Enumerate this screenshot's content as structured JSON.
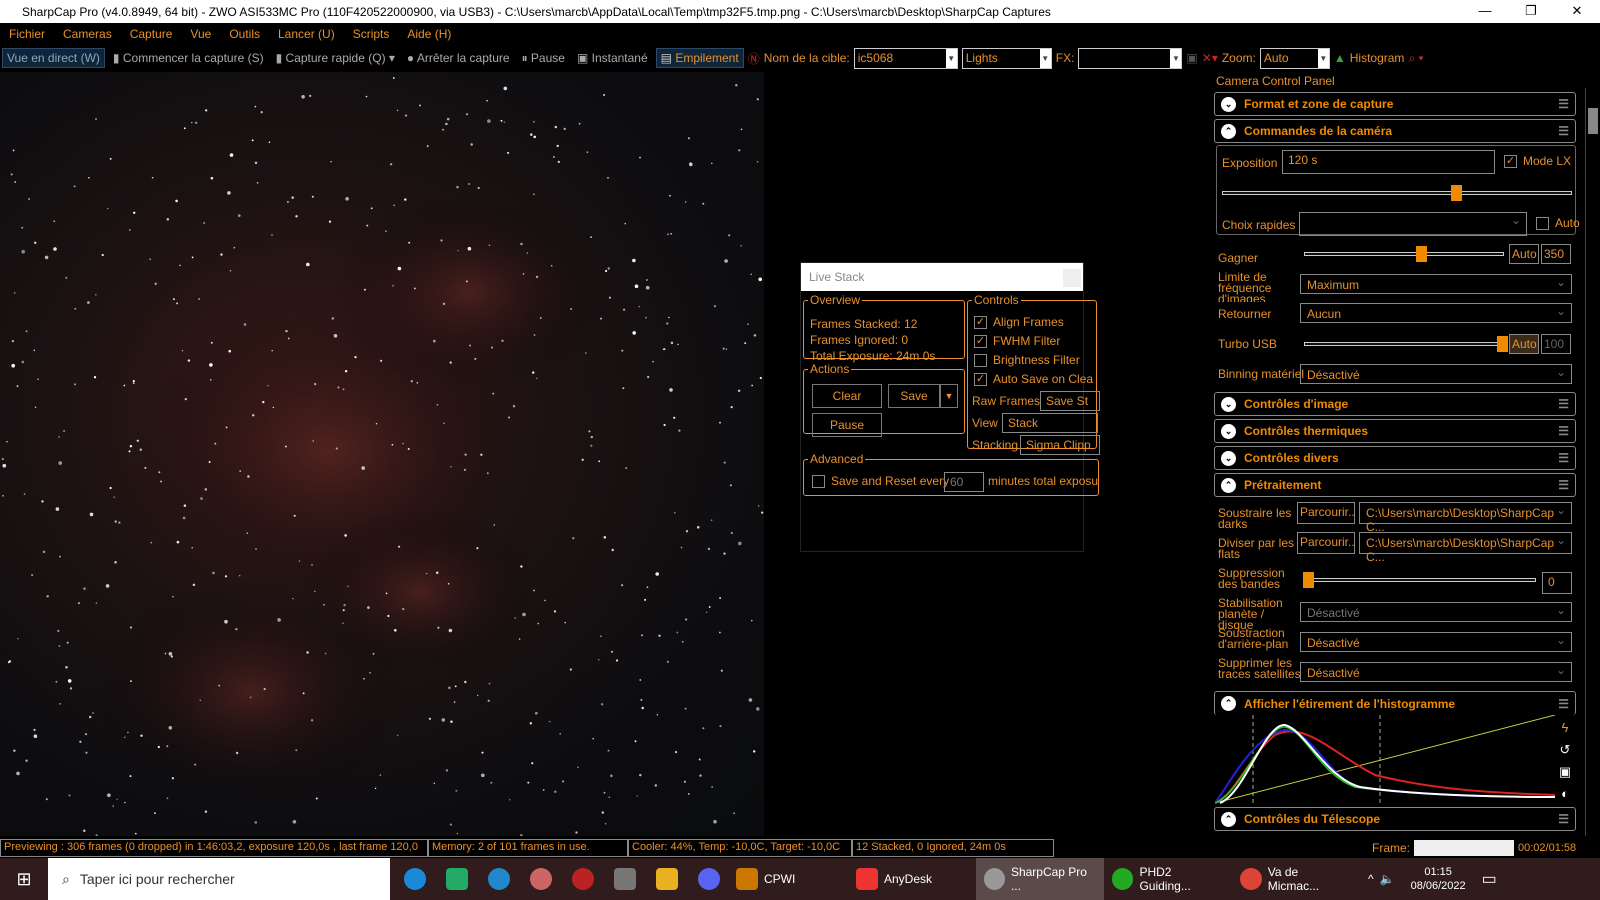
{
  "window": {
    "title": "SharpCap Pro (v4.0.8949, 64 bit) - ZWO ASI533MC Pro (110F420522000900, via USB3) - C:\\Users\\marcb\\AppData\\Local\\Temp\\tmp32F5.tmp.png - C:\\Users\\marcb\\Desktop\\SharpCap Captures"
  },
  "menu": [
    "Fichier",
    "Cameras",
    "Capture",
    "Vue",
    "Outils",
    "Lancer (U)",
    "Scripts",
    "Aide (H)"
  ],
  "toolbar": {
    "live_view": "Vue en direct (W)",
    "start_capture": "Commencer la capture (S)",
    "quick_capture": "Capture rapide (Q)",
    "stop_capture": "Arrêter la capture",
    "pause": "Pause",
    "snapshot": "Instantané",
    "stacking": "Empilement",
    "target_label": "Nom de la cible:",
    "target_value": "ic5068",
    "frame_type": "Lights",
    "fx_label": "FX:",
    "fx_value": "",
    "zoom_label": "Zoom:",
    "zoom_value": "Auto",
    "histogram": "Histogram"
  },
  "live_stack": {
    "title": "Live Stack",
    "overview": {
      "legend": "Overview",
      "frames_stacked": "Frames Stacked: 12",
      "frames_ignored": "Frames Ignored:  0",
      "total_exposure": "Total Exposure:   24m 0s"
    },
    "actions": {
      "legend": "Actions",
      "clear": "Clear",
      "save": "Save",
      "pause": "Pause"
    },
    "controls": {
      "legend": "Controls",
      "align": "Align Frames",
      "fwhm": "FWHM Filter",
      "brightness": "Brightness Filter",
      "autosave": "Auto Save on Clea",
      "raw_frames_label": "Raw Frames",
      "raw_frames_value": "Save St",
      "view_label": "View",
      "view_value": "Stack",
      "stacking_label": "Stacking",
      "stacking_value": "Sigma Clipp"
    },
    "advanced": {
      "legend": "Advanced",
      "save_reset": "Save and Reset every",
      "minutes": "60",
      "suffix": "minutes total exposu"
    }
  },
  "panel": {
    "title": "Camera Control Panel",
    "sections": {
      "format": "Format et zone de capture",
      "camera": "Commandes de la caméra",
      "image": "Contrôles d'image",
      "thermal": "Contrôles thermiques",
      "misc": "Contrôles divers",
      "preproc": "Prétraitement",
      "histo": "Afficher l'étirement de l'histogramme",
      "telescope": "Contrôles du Télescope"
    },
    "exposure_label": "Exposition",
    "exposure_value": "120 s",
    "mode_lx": "Mode LX",
    "quick_label": "Choix rapides",
    "auto": "Auto",
    "gain_label": "Gagner",
    "gain_value": "350",
    "gain_fraction": 0.58,
    "fps_label": "Limite de fréquence d'images",
    "fps_value": "Maximum",
    "flip_label": "Retourner",
    "flip_value": "Aucun",
    "usb_label": "Turbo USB",
    "usb_value": "100",
    "binning_label": "Binning matériel",
    "binning_value": "Désactivé",
    "darks_label": "Soustraire les darks",
    "flats_label": "Diviser par les flats",
    "browse": "Parcourir...",
    "darks_path": "C:\\Users\\marcb\\Desktop\\SharpCap C...",
    "flats_path": "C:\\Users\\marcb\\Desktop\\SharpCap C...",
    "banding_label": "Suppression des bandes",
    "banding_value": "0",
    "stab_label": "Stabilisation planète / disque",
    "stab_value": "Désactivé",
    "bg_label": "Soustraction d'arrière-plan",
    "bg_value": "Désactivé",
    "sat_label": "Supprimer les traces satellites",
    "sat_value": "Désactivé"
  },
  "status": {
    "preview": "Previewing : 306 frames (0 dropped) in 1:46:03,2, exposure 120,0s , last frame 120,0",
    "memory": "Memory: 2 of 101 frames in use.",
    "cooler": "Cooler: 44%, Temp: -10,0C, Target: -10,0C",
    "stack": "12 Stacked, 0 Ignored, 24m 0s",
    "frame_label": "Frame:",
    "time": "00:02/01:58"
  },
  "taskbar": {
    "search": "Taper ici pour rechercher",
    "apps": [
      "CPWI",
      "AnyDesk",
      "SharpCap Pro ...",
      "PHD2 Guiding...",
      "Va de Micmac..."
    ],
    "clock_time": "01:15",
    "clock_date": "08/06/2022"
  }
}
